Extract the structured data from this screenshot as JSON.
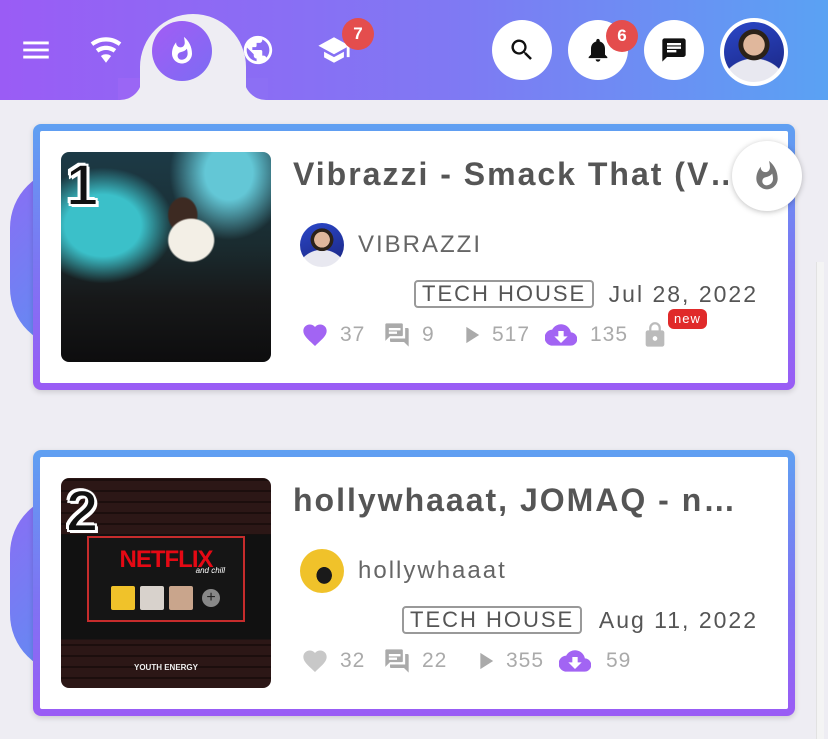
{
  "topbar": {
    "icons": [
      "menu-icon",
      "wifi-icon",
      "fire-icon",
      "globe-icon",
      "school-icon",
      "search-icon",
      "bell-icon",
      "chat-icon"
    ],
    "school_badge": "7",
    "notifications_badge": "6",
    "colors": {
      "gradient_start": "#9a5cf5",
      "gradient_end": "#5aa2f3",
      "badge": "#e44d4d"
    }
  },
  "tracks": [
    {
      "rank": "1",
      "title": "Vibrazzi - Smack That (Vibrazzi Remix)",
      "artist": "VIBRAZZI",
      "genre": "TECH HOUSE",
      "date": "Jul 28, 2022",
      "likes": "37",
      "comments": "9",
      "plays": "517",
      "downloads": "135",
      "new_label": "new",
      "liked": true
    },
    {
      "rank": "2",
      "title": "hollywhaaat, JOMAQ - netflix and chill",
      "artist": "hollywhaaat",
      "genre": "TECH HOUSE",
      "date": "Aug 11, 2022",
      "likes": "32",
      "comments": "22",
      "plays": "355",
      "downloads": "59",
      "liked": false,
      "cover": {
        "title": "NETFLIX",
        "subtitle": "and chill",
        "brand": "YOUTH ENERGY"
      }
    }
  ],
  "accent_colors": {
    "purple": "#a264f3",
    "new_badge": "#e02a2a"
  }
}
